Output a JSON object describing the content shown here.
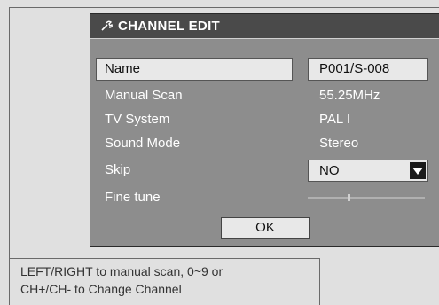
{
  "dialog": {
    "title": "CHANNEL EDIT",
    "title_icon": "wrench-icon",
    "rows": {
      "name": {
        "label": "Name",
        "value": "P001/S-008"
      },
      "manual_scan": {
        "label": "Manual Scan",
        "value": "55.25MHz"
      },
      "tv_system": {
        "label": "TV System",
        "value": "PAL I"
      },
      "sound_mode": {
        "label": "Sound Mode",
        "value": "Stereo"
      },
      "skip": {
        "label": "Skip",
        "value": "NO"
      },
      "fine_tune": {
        "label": "Fine tune",
        "level": 0.35
      }
    },
    "ok_label": "OK"
  },
  "hint": {
    "line1": "LEFT/RIGHT to manual scan, 0~9 or",
    "line2": "CH+/CH- to Change Channel"
  },
  "colors": {
    "dialog_bg": "#8d8d8d",
    "titlebar_bg": "#4a4a4a",
    "field_bg": "#e8e8e8",
    "screen_bg": "#e0e0e0"
  }
}
